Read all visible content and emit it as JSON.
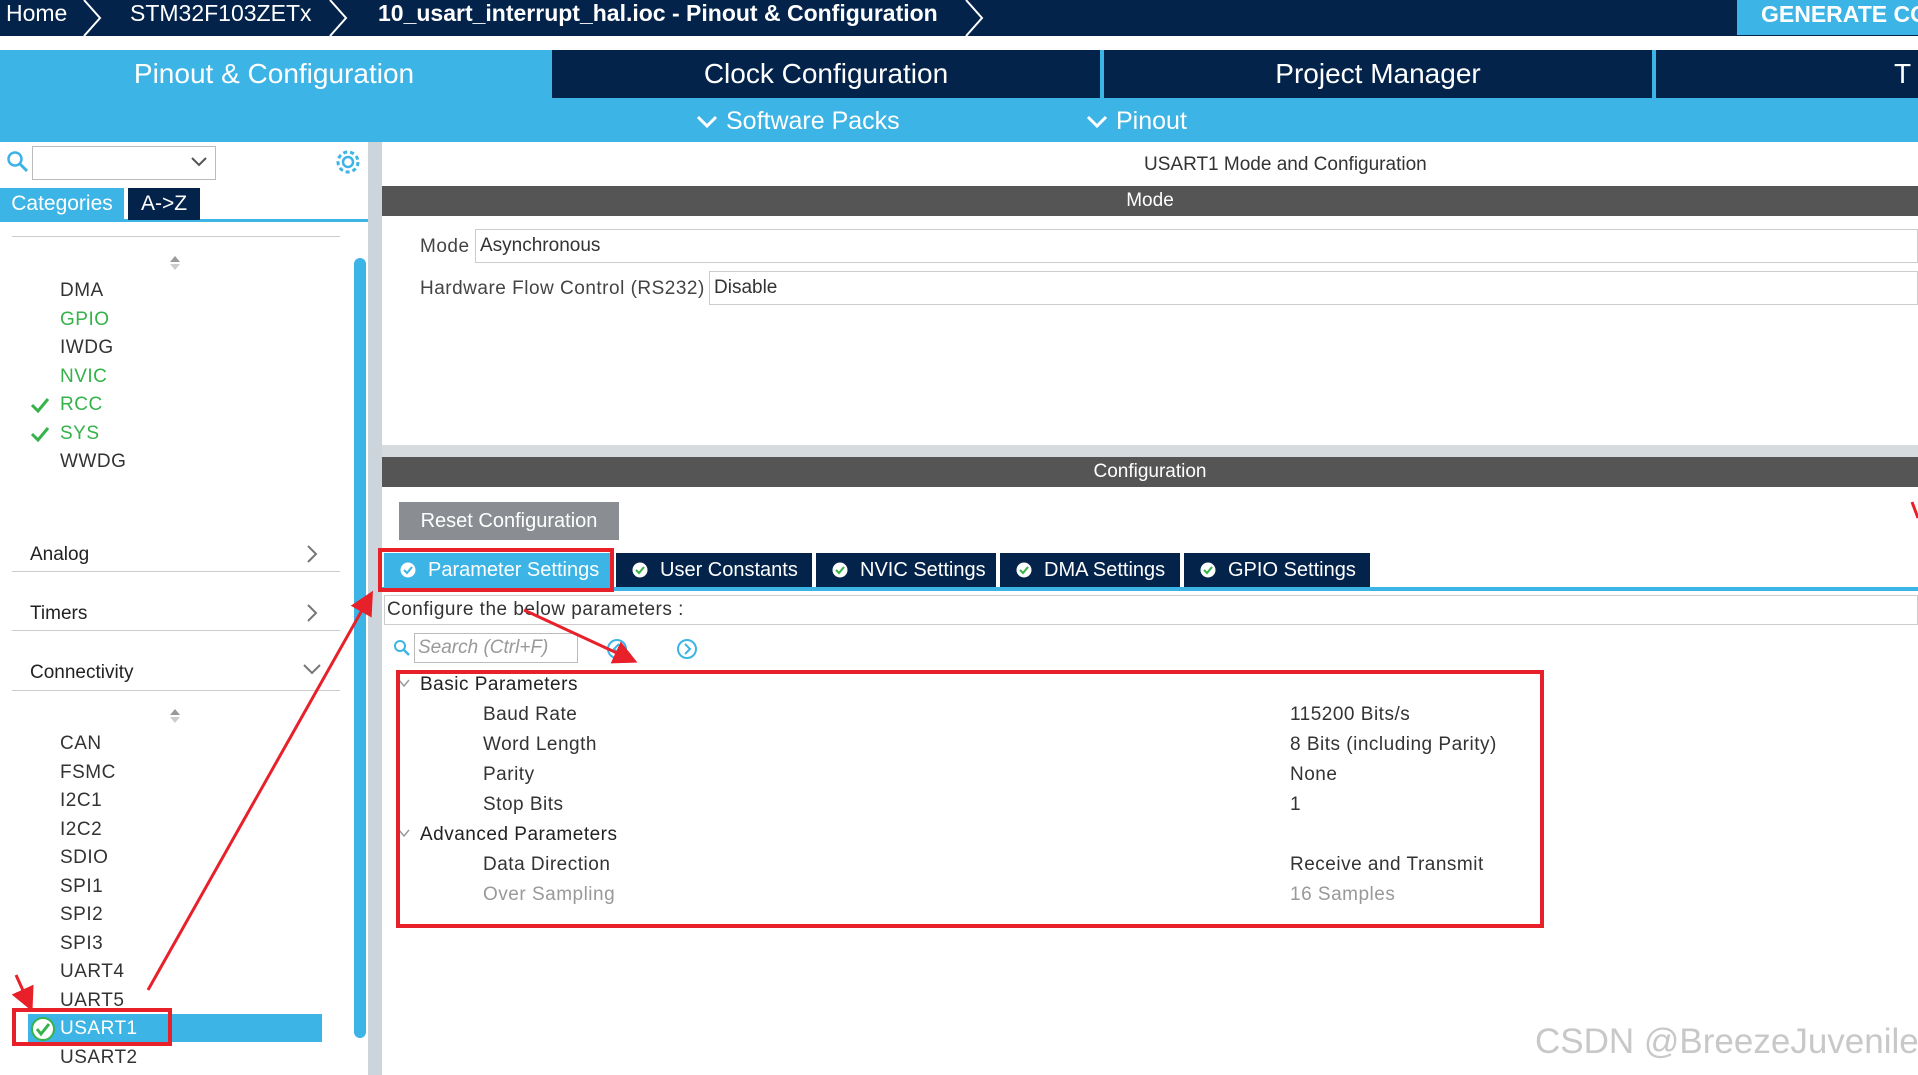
{
  "breadcrumb": {
    "home": "Home",
    "device": "STM32F103ZETx",
    "file": "10_usart_interrupt_hal.ioc - Pinout & Configuration"
  },
  "generate_label": "GENERATE CO",
  "main_tabs": [
    "Pinout & Configuration",
    "Clock Configuration",
    "Project Manager",
    "T"
  ],
  "sub_tabs": [
    "Software Packs",
    "Pinout"
  ],
  "sidebar": {
    "category_tabs": [
      "Categories",
      "A->Z"
    ],
    "system_items": [
      "DMA",
      "GPIO",
      "IWDG",
      "NVIC",
      "RCC",
      "SYS",
      "WWDG"
    ],
    "categories": [
      "Analog",
      "Timers",
      "Connectivity"
    ],
    "connectivity_items": [
      "CAN",
      "FSMC",
      "I2C1",
      "I2C2",
      "SDIO",
      "SPI1",
      "SPI2",
      "SPI3",
      "UART4",
      "UART5",
      "USART1",
      "USART2"
    ]
  },
  "main": {
    "title": "USART1 Mode and Configuration",
    "mode_header": "Mode",
    "mode_label": "Mode",
    "mode_value": "Asynchronous",
    "hwflow_label": "Hardware Flow Control (RS232)",
    "hwflow_value": "Disable",
    "config_header": "Configuration",
    "reset_label": "Reset Configuration",
    "param_tabs": [
      "Parameter Settings",
      "User Constants",
      "NVIC Settings",
      "DMA Settings",
      "GPIO Settings"
    ],
    "configure_text": "Configure the below parameters :",
    "search_placeholder": "Search (Ctrl+F)",
    "basic_group": "Basic Parameters",
    "basic_params": [
      {
        "name": "Baud Rate",
        "value": "115200 Bits/s"
      },
      {
        "name": "Word Length",
        "value": "8 Bits (including Parity)"
      },
      {
        "name": "Parity",
        "value": "None"
      },
      {
        "name": "Stop Bits",
        "value": "1"
      }
    ],
    "advanced_group": "Advanced Parameters",
    "advanced_params": [
      {
        "name": "Data Direction",
        "value": "Receive and Transmit"
      },
      {
        "name": "Over Sampling",
        "value": "16 Samples"
      }
    ]
  },
  "watermark": "CSDN @BreezeJuvenile",
  "colors": {
    "accent": "#3cb4e6",
    "navy": "#03234b",
    "green": "#36b24a",
    "annotation": "#e8202a"
  }
}
